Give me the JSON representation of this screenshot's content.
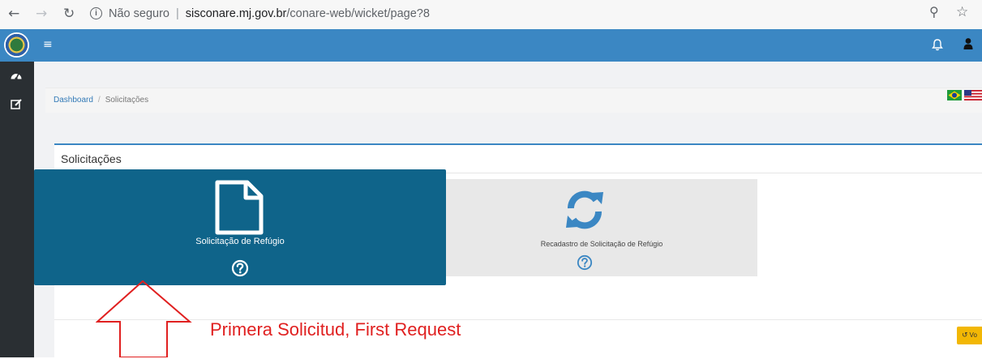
{
  "browser": {
    "back_icon": "arrow-left-icon",
    "forward_icon": "arrow-right-icon",
    "reload_icon": "reload-icon",
    "security_text": "Não seguro",
    "url_host": "sisconare.mj.gov.br",
    "url_path": "/conare-web/wicket/page?8",
    "zoom_icon": "zoom-icon",
    "bookmark_icon": "star-icon"
  },
  "appbar": {
    "color": "#3b87c3",
    "menu_icon": "hamburger-icon",
    "notification_icon": "bell-icon",
    "user_icon": "user-icon"
  },
  "sidebar": {
    "color": "#2a2f33",
    "items": [
      {
        "icon": "dashboard-icon"
      },
      {
        "icon": "edit-icon"
      }
    ]
  },
  "breadcrumb": {
    "items": [
      "Dashboard",
      "Solicitações"
    ],
    "languages": [
      "pt-BR",
      "en-US"
    ]
  },
  "panel": {
    "title": "Solicitações",
    "accent": "#3b87c3"
  },
  "tiles": [
    {
      "label": "Solicitação de Refúgio",
      "icon": "document-icon",
      "help_icon": "question-circle-icon",
      "color": "#0f648a"
    },
    {
      "label": "Recadastro de Solicitação de Refúgio",
      "icon": "sync-icon",
      "help_icon": "question-circle-icon",
      "color": "#e8e8e8"
    }
  ],
  "annotation": {
    "text": "Primera Solicitud, First Request",
    "color": "#e02020"
  },
  "back_button": {
    "label": "Vo",
    "icon": "undo-icon",
    "color": "#f2b705"
  }
}
